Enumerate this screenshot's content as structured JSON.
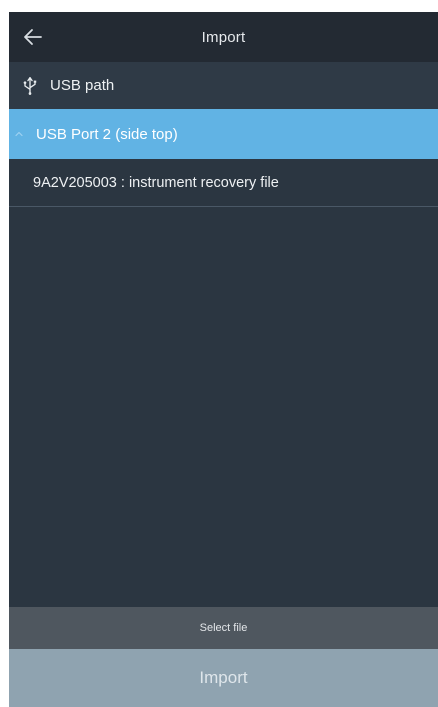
{
  "header": {
    "title": "Import",
    "back_icon": "arrow-left-icon"
  },
  "path": {
    "icon": "usb-icon",
    "label": "USB path"
  },
  "tree": {
    "expanded_port": {
      "icon": "chevron-up-icon",
      "label": "USB Port 2 (side top)",
      "selected": true
    },
    "files": [
      {
        "label": "9A2V205003 : instrument recovery file"
      }
    ]
  },
  "footer": {
    "select_file_label": "Select file",
    "import_label": "Import"
  },
  "colors": {
    "topbar": "#232a33",
    "background": "#2b3641",
    "selected_row": "#61b3e4",
    "select_file_bar": "#4f575f",
    "import_button": "#8fa3b0"
  }
}
